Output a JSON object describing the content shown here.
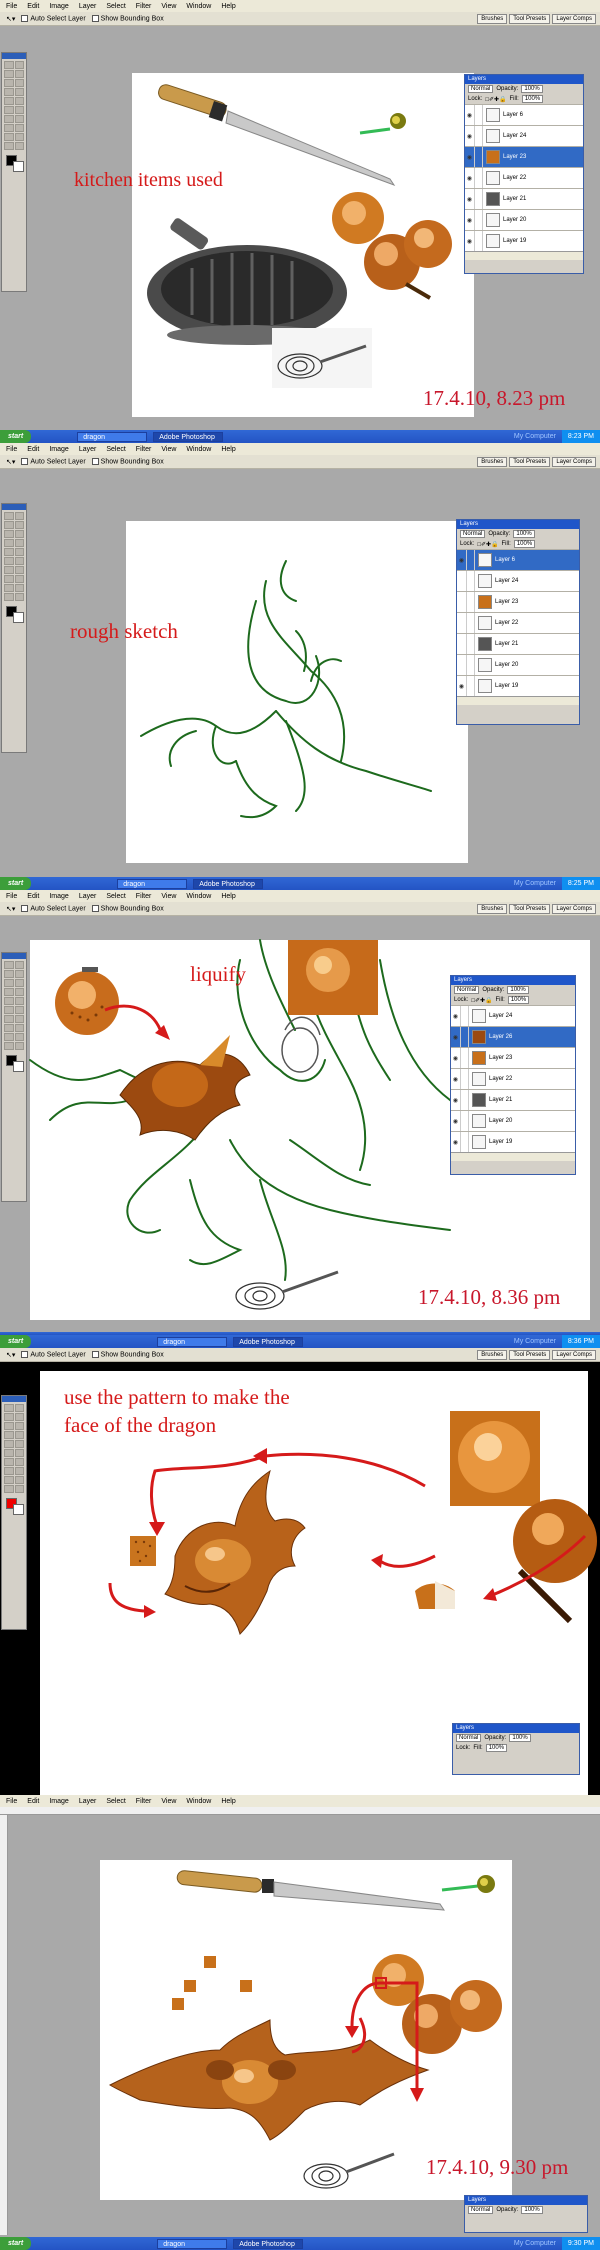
{
  "menu": {
    "items": [
      "File",
      "Edit",
      "Image",
      "Layer",
      "Select",
      "Filter",
      "View",
      "Window",
      "Help"
    ]
  },
  "options_bar": {
    "auto_select": "Auto Select Layer",
    "bounding_box": "Show Bounding Box"
  },
  "palette_well": {
    "brushes": "Brushes",
    "tool_presets": "Tool Presets",
    "layer_comps": "Layer Comps"
  },
  "layers_panel": {
    "title": "Layers",
    "blend_mode": "Normal",
    "opacity_label": "Opacity:",
    "opacity_value": "100%",
    "lock_label": "Lock:",
    "fill_label": "Fill:",
    "fill_value": "100%",
    "panel1": [
      "Layer 6",
      "Layer 24",
      "Layer 23",
      "Layer 22",
      "Layer 21",
      "Layer 20",
      "Layer 19"
    ],
    "panel2": [
      "Layer 6",
      "Layer 24",
      "Layer 23",
      "Layer 22",
      "Layer 21",
      "Layer 20",
      "Layer 19"
    ],
    "panel3": [
      "Layer 24",
      "Layer 26",
      "Layer 23",
      "Layer 22",
      "Layer 21",
      "Layer 20",
      "Layer 19"
    ]
  },
  "annotations": {
    "kitchen": "kitchen items used",
    "sketch": "rough sketch",
    "liquify": "liquify",
    "pattern_line1": "use the pattern to make the",
    "pattern_line2": "face of the dragon"
  },
  "timestamps": {
    "t1": "17.4.10, 8.23 pm",
    "t2": "17.4.10, 8.36 pm",
    "t3": "17.4.10, 9.30 pm"
  },
  "taskbar": {
    "start": "start",
    "folder": "dragon",
    "app": "Adobe Photoshop",
    "my_computer": "My Computer",
    "clock1": "8:23 PM",
    "clock2": "8:25 PM",
    "clock3": "8:36 PM",
    "clock4": "9:30 PM"
  },
  "colors": {
    "annotation_red": "#d51a1a",
    "stroke_green": "#1d6a1d",
    "copper": "#c8701a",
    "selected_layer": "#316ac5"
  }
}
